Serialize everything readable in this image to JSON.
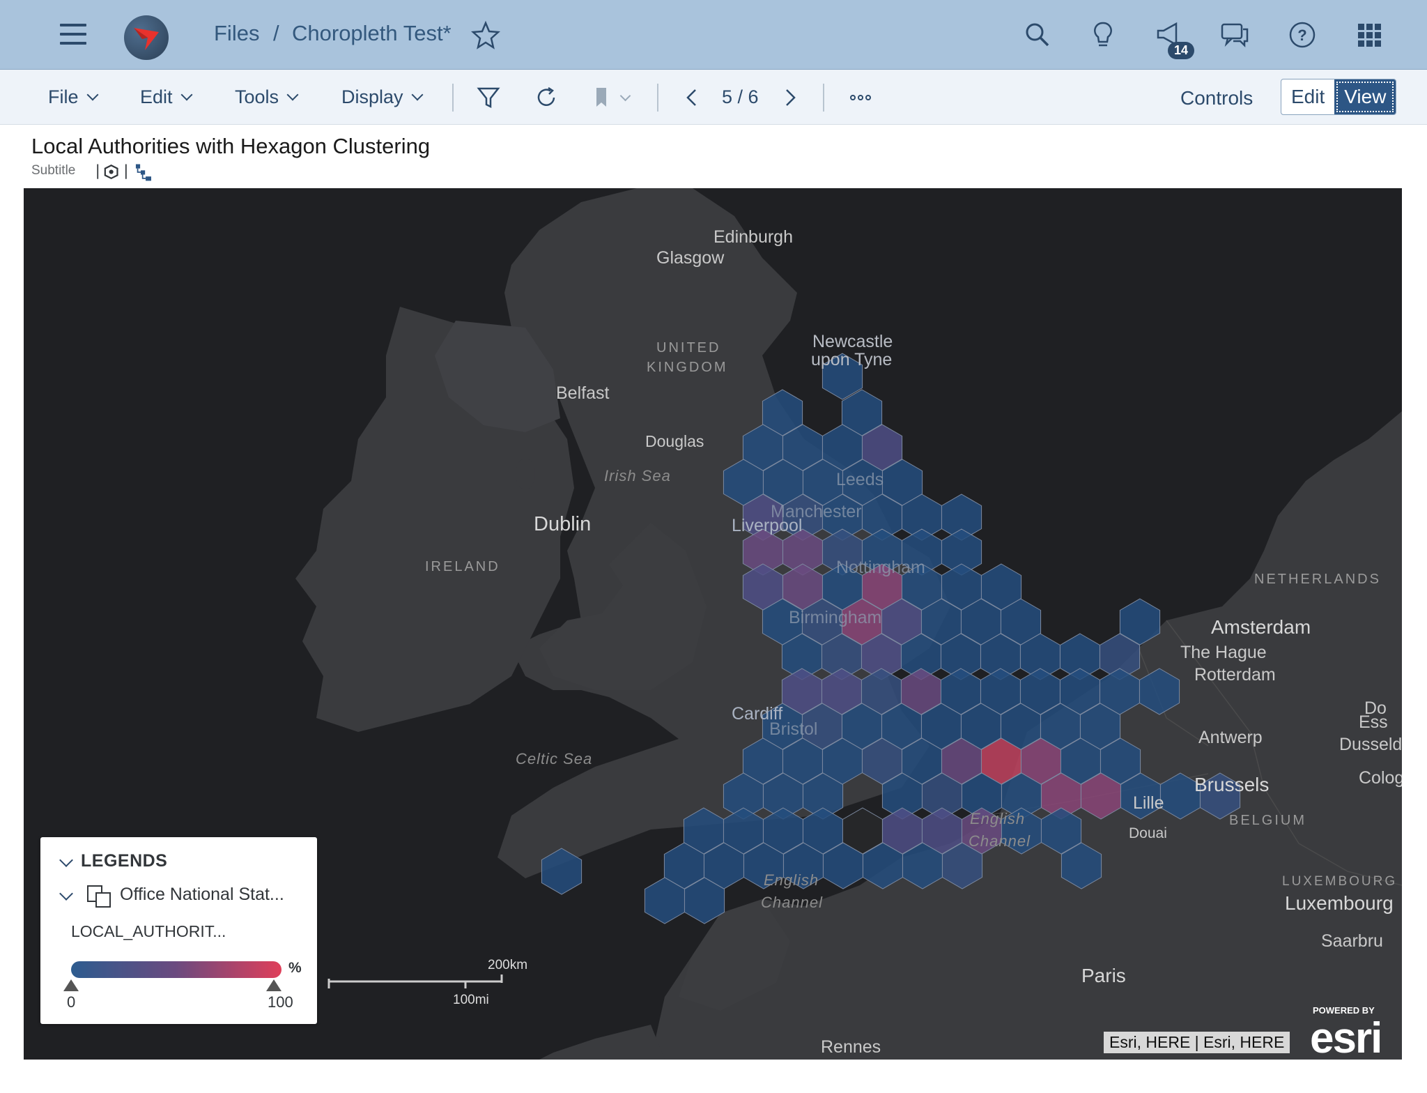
{
  "shell": {
    "breadcrumb_files": "Files",
    "breadcrumb_sep": "/",
    "document_title": "Choropleth Test*",
    "notification_count": "14"
  },
  "toolbar": {
    "file": "File",
    "edit": "Edit",
    "tools": "Tools",
    "display": "Display",
    "page_indicator": "5 / 6",
    "controls": "Controls",
    "edit_mode": "Edit",
    "view_mode": "View"
  },
  "widget": {
    "title": "Local Authorities with Hexagon Clustering",
    "subtitle": "Subtitle"
  },
  "map": {
    "labels": {
      "edinburgh": "Edinburgh",
      "glasgow": "Glasgow",
      "newcastle_1": "Newcastle",
      "newcastle_2": "upon Tyne",
      "uk_1": "UNITED",
      "uk_2": "KINGDOM",
      "belfast": "Belfast",
      "douglas": "Douglas",
      "irish_sea": "Irish Sea",
      "dublin": "Dublin",
      "ireland": "IRELAND",
      "leeds": "Leeds",
      "manchester": "Manchester",
      "liverpool": "Liverpool",
      "nottingham": "Nottingham",
      "birmingham": "Birmingham",
      "cardiff": "Cardiff",
      "bristol": "Bristol",
      "celtic_sea": "Celtic Sea",
      "english_channel_1": "English",
      "english_channel_2": "Channel",
      "english_channel_3": "English",
      "english_channel_4": "Channel",
      "netherlands": "NETHERLANDS",
      "amsterdam": "Amsterdam",
      "the_hague": "The Hague",
      "rotterdam": "Rotterdam",
      "antwerp": "Antwerp",
      "brussels": "Brussels",
      "belgium": "BELGIUM",
      "lille": "Lille",
      "douai": "Douai",
      "luxembourg_country": "LUXEMBOURG",
      "luxembourg": "Luxembourg",
      "saarbrucken": "Saarbru",
      "paris": "Paris",
      "rennes": "Rennes",
      "dusseldorf": "Dusseld",
      "essen": "Ess",
      "dortmund": "Do",
      "cologne": "Colog"
    },
    "legend": {
      "header": "LEGENDS",
      "layer_name": "Office National Stat...",
      "field": "LOCAL_AUTHORIT...",
      "unit": "%",
      "min": "0",
      "max": "100",
      "color_low": "#2d5c8f",
      "color_mid": "#6b4a7f",
      "color_high": "#df3f5a"
    },
    "scalebar": {
      "km": "200km",
      "mi": "100mi"
    },
    "attribution": "Esri, HERE | Esri, HERE",
    "powered_by": "POWERED BY",
    "esri_logo": "esri"
  },
  "colors": {
    "shell_bg": "#a9c3dc",
    "toolbar_bg": "#eef3f9",
    "accent": "#2d5685",
    "map_bg": "#1f2023",
    "land": "#3a3b3e"
  }
}
